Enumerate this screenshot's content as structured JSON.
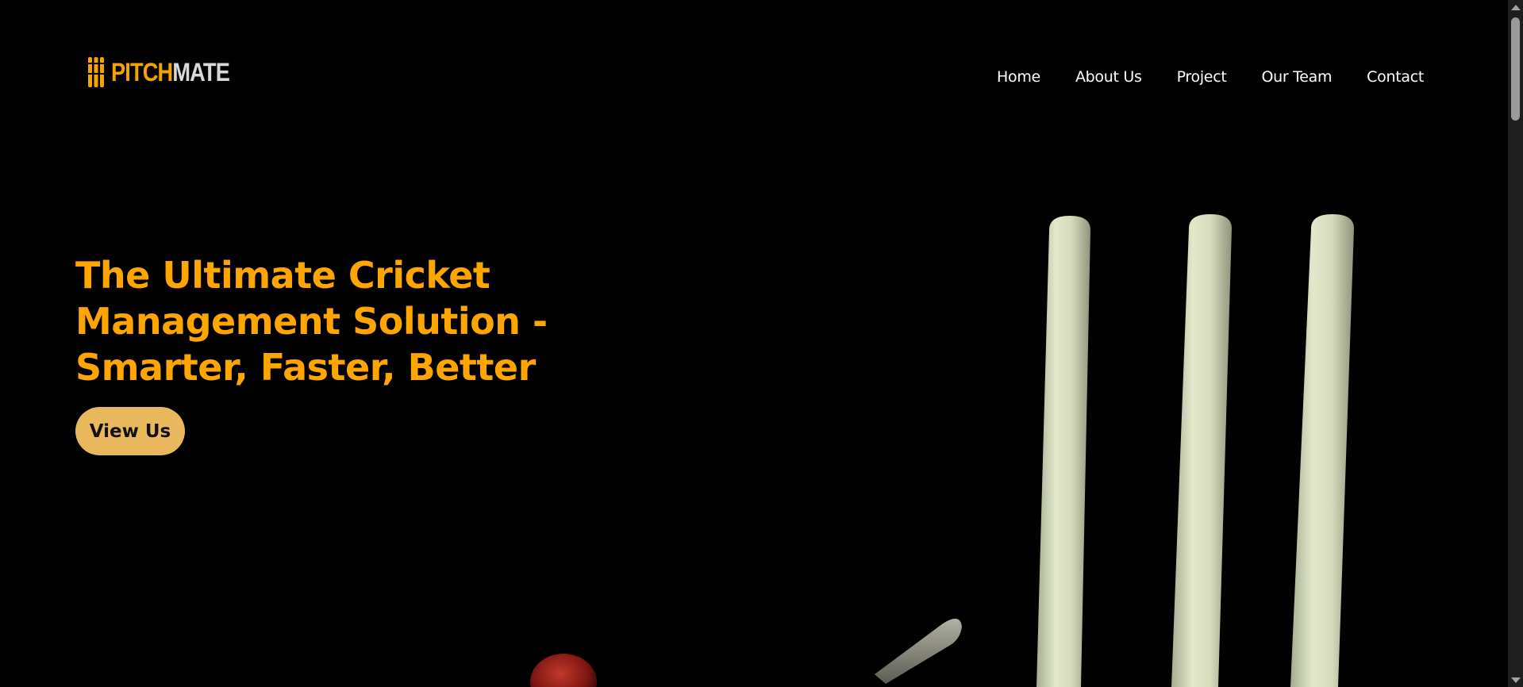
{
  "header": {
    "logo": {
      "part1": "PITCH",
      "part2": "MATE",
      "part1_color": "#f5a300",
      "part2_color": "#d9d9d9",
      "icon": "cricket-stumps-icon"
    },
    "nav": [
      {
        "label": "Home"
      },
      {
        "label": "About Us"
      },
      {
        "label": "Project"
      },
      {
        "label": "Our Team"
      },
      {
        "label": "Contact"
      }
    ]
  },
  "hero": {
    "title_lines": [
      "The Ultimate Cricket",
      "Management Solution -",
      "Smarter, Faster, Better"
    ],
    "cta_label": "View Us",
    "title_color": "#ffa500",
    "cta_color": "#e9b75c"
  },
  "theme": {
    "background": "#000000"
  }
}
